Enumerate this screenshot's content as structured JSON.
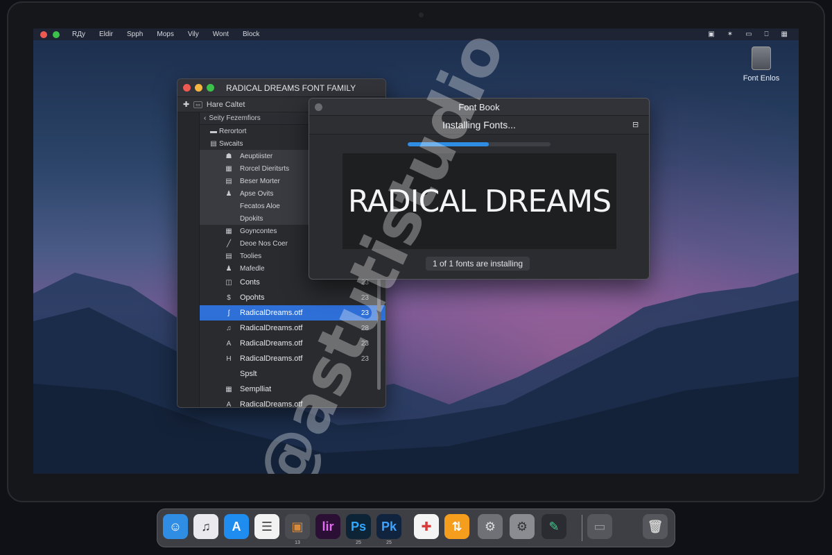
{
  "menubar": {
    "menus": [
      "RДy",
      "Eldir",
      "Spph",
      "Mops",
      "Vily",
      "Wont",
      "Block"
    ],
    "right_icons": [
      "image-icon",
      "star-icon",
      "battery-icon",
      "display-icon",
      "grid-icon"
    ]
  },
  "desktop": {
    "icon_label": "Font Enlos"
  },
  "left_window": {
    "title": "RADICAL DREAMS FONT FAMILY",
    "toolbar_label": "Hare Caltet",
    "header_label": "Seity Fezemfiors",
    "rows": [
      {
        "label": "Rerortort",
        "icon": "folder",
        "count": ""
      },
      {
        "label": "Swcaits",
        "icon": "doc",
        "count": ""
      },
      {
        "label": "Aeuptiister",
        "icon": "group",
        "count": ""
      },
      {
        "label": "Rorcel Dieritsrts",
        "icon": "grid",
        "count": ""
      },
      {
        "label": "Beser Morter",
        "icon": "list",
        "count": ""
      },
      {
        "label": "Apse Ovits",
        "icon": "person",
        "count": ""
      },
      {
        "label": "Fecatos Aloe",
        "icon": "",
        "count": ""
      },
      {
        "label": "Dpokits",
        "icon": "",
        "count": ""
      },
      {
        "label": "Goyncontes",
        "icon": "grid",
        "count": ""
      },
      {
        "label": "Deoe Nos Coer",
        "icon": "slash",
        "count": ""
      },
      {
        "label": "Toolies",
        "icon": "list",
        "count": ""
      },
      {
        "label": "Mafedle",
        "icon": "person",
        "count": ""
      },
      {
        "label": "Conts",
        "icon": "layers",
        "count": "23"
      },
      {
        "label": "Opohts",
        "icon": "dollar",
        "count": "23"
      },
      {
        "label": "RadicalDreams.otf",
        "icon": "font",
        "count": "23",
        "selected": true
      },
      {
        "label": "RadicalDreams.otf",
        "icon": "note",
        "count": "28"
      },
      {
        "label": "RadicalDreams.otf",
        "icon": "A",
        "count": "23"
      },
      {
        "label": "RadicalDreams.otf",
        "icon": "H",
        "count": "23"
      },
      {
        "label": "Spslt",
        "icon": "",
        "count": ""
      },
      {
        "label": "Semplliat",
        "icon": "grid",
        "count": ""
      },
      {
        "label": "RadicalDreams.otf",
        "icon": "A",
        "count": ""
      }
    ]
  },
  "font_book": {
    "title": "Font Book",
    "subtitle": "Installing Fonts...",
    "progress": 0.57,
    "preview_text": "RADICAL DREAMS",
    "status": "1 of 1 fonts are installing"
  },
  "watermark": "@astutistudio",
  "dock": {
    "items": [
      {
        "name": "finder-icon",
        "glyph": "☺",
        "bg": "#2f8de4",
        "fg": "#fff",
        "num": ""
      },
      {
        "name": "music-icon",
        "glyph": "♫",
        "bg": "#e9e9ee",
        "fg": "#333",
        "num": ""
      },
      {
        "name": "app-store-icon",
        "glyph": "A",
        "bg": "#1f8df0",
        "fg": "#fff",
        "num": ""
      },
      {
        "name": "notes-icon",
        "glyph": "☰",
        "bg": "#f2f2f2",
        "fg": "#444",
        "num": ""
      },
      {
        "name": "package-icon",
        "glyph": "▣",
        "bg": "#4a4c52",
        "fg": "#d98b3c",
        "num": "13"
      },
      {
        "name": "illustrator-icon",
        "glyph": "lir",
        "bg": "#2b0f35",
        "fg": "#e46cf3",
        "num": ""
      },
      {
        "name": "photoshop-icon",
        "glyph": "Ps",
        "bg": "#0c2436",
        "fg": "#31a8ff",
        "num": "25"
      },
      {
        "name": "pixelmator-icon",
        "glyph": "Pk",
        "bg": "#10233f",
        "fg": "#3ea2ff",
        "num": "25"
      },
      {
        "name": "cards-icon",
        "glyph": "✚",
        "bg": "#f4f4f4",
        "fg": "#d93a3a",
        "num": ""
      },
      {
        "name": "tools-icon",
        "glyph": "⇅",
        "bg": "#f59d1c",
        "fg": "#fff",
        "num": ""
      },
      {
        "name": "settings-gear-icon",
        "glyph": "⚙",
        "bg": "#6f7177",
        "fg": "#ddd",
        "num": ""
      },
      {
        "name": "system-preferences-icon",
        "glyph": "⚙",
        "bg": "#8a8c92",
        "fg": "#333",
        "num": ""
      },
      {
        "name": "paint-icon",
        "glyph": "✎",
        "bg": "#2a2c31",
        "fg": "#3ecf8e",
        "num": ""
      },
      {
        "name": "window-icon",
        "glyph": "▭",
        "bg": "#55575d",
        "fg": "#999",
        "num": ""
      },
      {
        "name": "trash-icon",
        "glyph": "🗑",
        "bg": "#55575d",
        "fg": "#ccc",
        "num": ""
      }
    ]
  }
}
